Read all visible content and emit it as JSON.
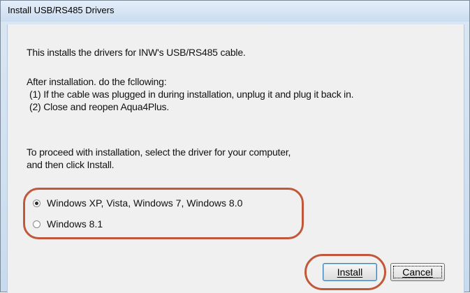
{
  "window": {
    "title": "Install USB/RS485 Drivers"
  },
  "body": {
    "intro": "This installs the drivers for INW's USB/RS485 cable.",
    "after_heading": "After installation. do the fcllowing:",
    "step1": "(1) If the cable was plugged in during installation, unplug it and plug it back in.",
    "step2": "(2) Close and reopen Aqua4Plus.",
    "proceed_line1": "To proceed with installation, select the driver for your computer,",
    "proceed_line2": "and then click Install."
  },
  "driver_options": [
    {
      "label": "Windows XP, Vista, Windows 7, Windows 8.0",
      "selected": true
    },
    {
      "label": "Windows 8.1",
      "selected": false
    }
  ],
  "buttons": {
    "install": "Install",
    "cancel": "Cancel"
  },
  "colors": {
    "highlight": "#c1583a",
    "title_bar": "#cadcf0",
    "dialog_bg": "#f0f0f0"
  }
}
